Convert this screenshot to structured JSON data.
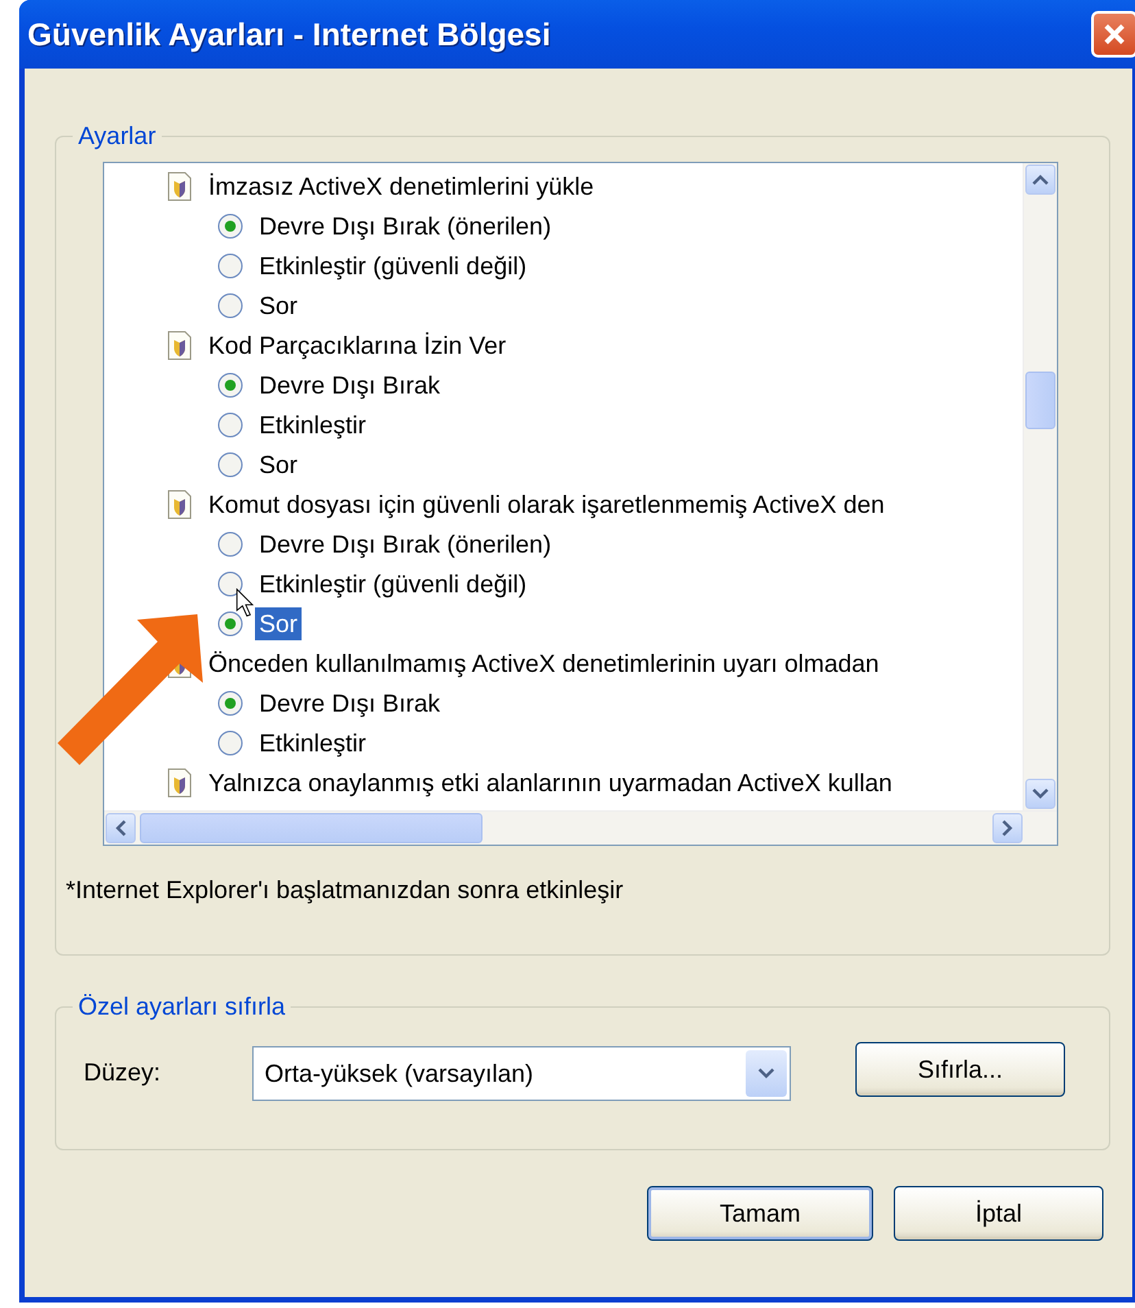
{
  "window": {
    "title": "Güvenlik Ayarları - Internet Bölgesi"
  },
  "settings_group": {
    "legend": "Ayarlar",
    "items": [
      {
        "label": "İmzasız ActiveX denetimlerini yükle",
        "children": [
          {
            "label": "Devre Dışı Bırak (önerilen)",
            "selected": true
          },
          {
            "label": "Etkinleştir (güvenli değil)",
            "selected": false
          },
          {
            "label": "Sor",
            "selected": false
          }
        ]
      },
      {
        "label": "Kod Parçacıklarına İzin Ver",
        "children": [
          {
            "label": "Devre Dışı Bırak",
            "selected": true
          },
          {
            "label": "Etkinleştir",
            "selected": false
          },
          {
            "label": "Sor",
            "selected": false
          }
        ]
      },
      {
        "label": "Komut dosyası için güvenli olarak işaretlenmemiş ActiveX den",
        "children": [
          {
            "label": "Devre Dışı Bırak (önerilen)",
            "selected": false
          },
          {
            "label": "Etkinleştir (güvenli değil)",
            "selected": false
          },
          {
            "label": "Sor",
            "selected": true
          }
        ]
      },
      {
        "label": "Önceden kullanılmamış ActiveX denetimlerinin uyarı olmadan",
        "children": [
          {
            "label": "Devre Dışı Bırak",
            "selected": true
          },
          {
            "label": "Etkinleştir",
            "selected": false
          }
        ]
      },
      {
        "label": "Yalnızca onaylanmış etki alanlarının uyarmadan ActiveX kullan"
      }
    ],
    "footnote": "*Internet Explorer'ı başlatmanızdan sonra etkinleşir"
  },
  "reset_group": {
    "legend": "Özel ayarları sıfırla",
    "level_label": "Düzey:",
    "level_value": "Orta-yüksek (varsayılan)",
    "reset_button": "Sıfırla..."
  },
  "buttons": [
    "Tamam",
    "İptal"
  ]
}
